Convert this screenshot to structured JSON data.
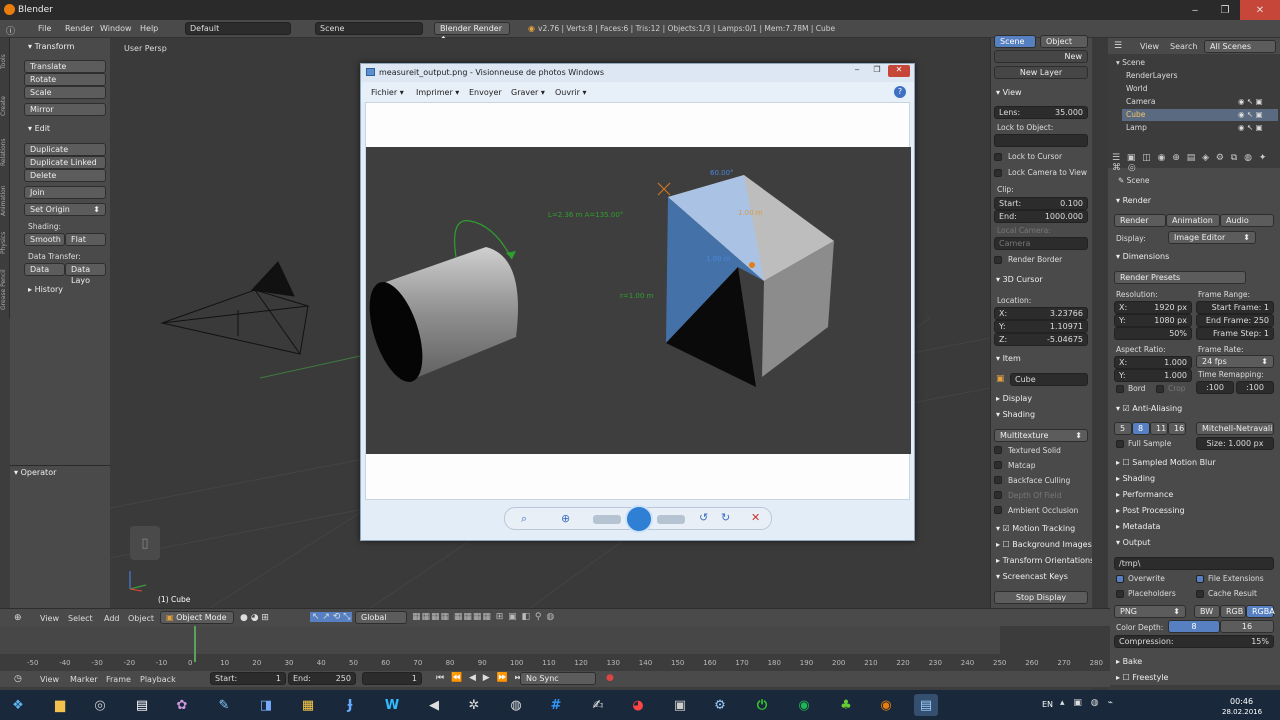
{
  "window": {
    "title": "Blender",
    "min": "‒",
    "max": "❐",
    "close": "✕"
  },
  "menu": {
    "file": "File",
    "render": "Render",
    "window": "Window",
    "help": "Help",
    "layout": "Default",
    "scene": "Scene",
    "engine": "Blender Render",
    "stats": "v2.76 | Verts:8 | Faces:6 | Tris:12 | Objects:1/3 | Lamps:0/1 | Mem:7.78M | Cube"
  },
  "tools": {
    "transform": "Transform",
    "translate": "Translate",
    "rotate": "Rotate",
    "scale": "Scale",
    "mirror": "Mirror",
    "edit": "Edit",
    "duplicate": "Duplicate",
    "duplicate_linked": "Duplicate Linked",
    "delete": "Delete",
    "join": "Join",
    "set_origin": "Set Origin",
    "shading": "Shading:",
    "smooth": "Smooth",
    "flat": "Flat",
    "data_transfer": "Data Transfer:",
    "data": "Data",
    "data_layo": "Data Layo",
    "history": "History",
    "operator": "Operator",
    "tabs": [
      "Tools",
      "Create",
      "Relations",
      "Animation",
      "Physics",
      "Grease Pencil"
    ]
  },
  "viewport": {
    "label": "User Persp",
    "object": "(1) Cube"
  },
  "viewer": {
    "title": "measureit_output.png - Visionneuse de photos Windows",
    "menus": [
      "Fichier",
      "Imprimer",
      "Envoyer",
      "Graver",
      "Ouvrir"
    ],
    "help": "?",
    "dim_angle": "L=2.36 m A=135.00°",
    "dim_radius": "r=1.00 m",
    "dim_top": "60.00°",
    "dim_mid": "1.00 m",
    "dim_left": "1.00 m"
  },
  "npanel": {
    "scene_btn": "Scene",
    "object_btn": "Object",
    "new_btn": "New",
    "new_layer": "New Layer",
    "view": "View",
    "lens_label": "Lens:",
    "lens": "35.000",
    "lock_to_object": "Lock to Object:",
    "lock_to_cursor": "Lock to Cursor",
    "lock_camera": "Lock Camera to View",
    "clip": "Clip:",
    "start_label": "Start:",
    "start": "0.100",
    "end_label": "End:",
    "end": "1000.000",
    "local_camera": "Local Camera:",
    "camera": "Camera",
    "render_border": "Render Border",
    "cursor": "3D Cursor",
    "location": "Location:",
    "x_label": "X:",
    "x": "3.23766",
    "y_label": "Y:",
    "y": "1.10971",
    "z_label": "Z:",
    "z": "-5.04675",
    "item": "Item",
    "item_name": "Cube",
    "display": "Display",
    "shading": "Shading",
    "multitexture": "Multitexture",
    "textured_solid": "Textured Solid",
    "matcap": "Matcap",
    "backface": "Backface Culling",
    "dof": "Depth Of Field",
    "ao": "Ambient Occlusion",
    "motion_tracking": "Motion Tracking",
    "bg_images": "Background Images",
    "transform_orient": "Transform Orientations",
    "screencast": "Screencast Keys",
    "stop_display": "Stop Display"
  },
  "outliner": {
    "view": "View",
    "search": "Search",
    "all_scenes": "All Scenes",
    "items": [
      "Scene",
      "RenderLayers",
      "World",
      "Camera",
      "Cube",
      "Lamp"
    ]
  },
  "props": {
    "scene": "Scene",
    "render": "Render",
    "render_btn": "Render",
    "animation_btn": "Animation",
    "audio_btn": "Audio",
    "display_label": "Display:",
    "display": "Image Editor",
    "dimensions": "Dimensions",
    "presets": "Render Presets",
    "resolution": "Resolution:",
    "res_x": "1920 px",
    "res_y": "1080 px",
    "res_pct": "50%",
    "frame_range": "Frame Range:",
    "start_frame": "Start Frame: 1",
    "end_frame": "End Frame: 250",
    "frame_step": "Frame Step: 1",
    "aspect": "Aspect Ratio:",
    "asp_x": "1.000",
    "asp_y": "1.000",
    "frame_rate": "Frame Rate:",
    "fps": "24 fps",
    "time_remap": "Time Remapping:",
    "remap_a": ":100",
    "remap_b": ":100",
    "bord": "Bord",
    "crop": "Crop",
    "aa": "Anti-Aliasing",
    "aa_vals": [
      "5",
      "8",
      "11",
      "16"
    ],
    "aa_filter": "Mitchell-Netravali",
    "full_sample": "Full Sample",
    "size": "Size: 1.000 px",
    "smb": "Sampled Motion Blur",
    "shading": "Shading",
    "performance": "Performance",
    "post": "Post Processing",
    "metadata": "Metadata",
    "output": "Output",
    "path": "/tmp\\",
    "overwrite": "Overwrite",
    "file_ext": "File Extensions",
    "placeholders": "Placeholders",
    "cache": "Cache Result",
    "format": "PNG",
    "bw": "BW",
    "rgb": "RGB",
    "rgba": "RGBA",
    "color_depth": "Color Depth:",
    "d8": "8",
    "d16": "16",
    "compression": "Compression:",
    "comp_val": "15%",
    "bake": "Bake",
    "freestyle": "Freestyle"
  },
  "vphdr": {
    "view": "View",
    "select": "Select",
    "add": "Add",
    "object": "Object",
    "mode": "Object Mode",
    "orient": "Global"
  },
  "timeline": {
    "ticks": [
      "-50",
      "-40",
      "-30",
      "-20",
      "-10",
      "0",
      "10",
      "20",
      "30",
      "40",
      "50",
      "60",
      "70",
      "80",
      "90",
      "100",
      "110",
      "120",
      "130",
      "140",
      "150",
      "160",
      "170",
      "180",
      "190",
      "200",
      "210",
      "220",
      "230",
      "240",
      "250",
      "260",
      "270",
      "280"
    ],
    "view": "View",
    "marker": "Marker",
    "frame": "Frame",
    "playback": "Playback",
    "start": "Start:",
    "start_val": "1",
    "end": "End:",
    "end_val": "250",
    "current": "1",
    "sync": "No Sync"
  },
  "taskbar": {
    "lang": "EN",
    "time": "00:46",
    "date": "28.02.2016"
  }
}
